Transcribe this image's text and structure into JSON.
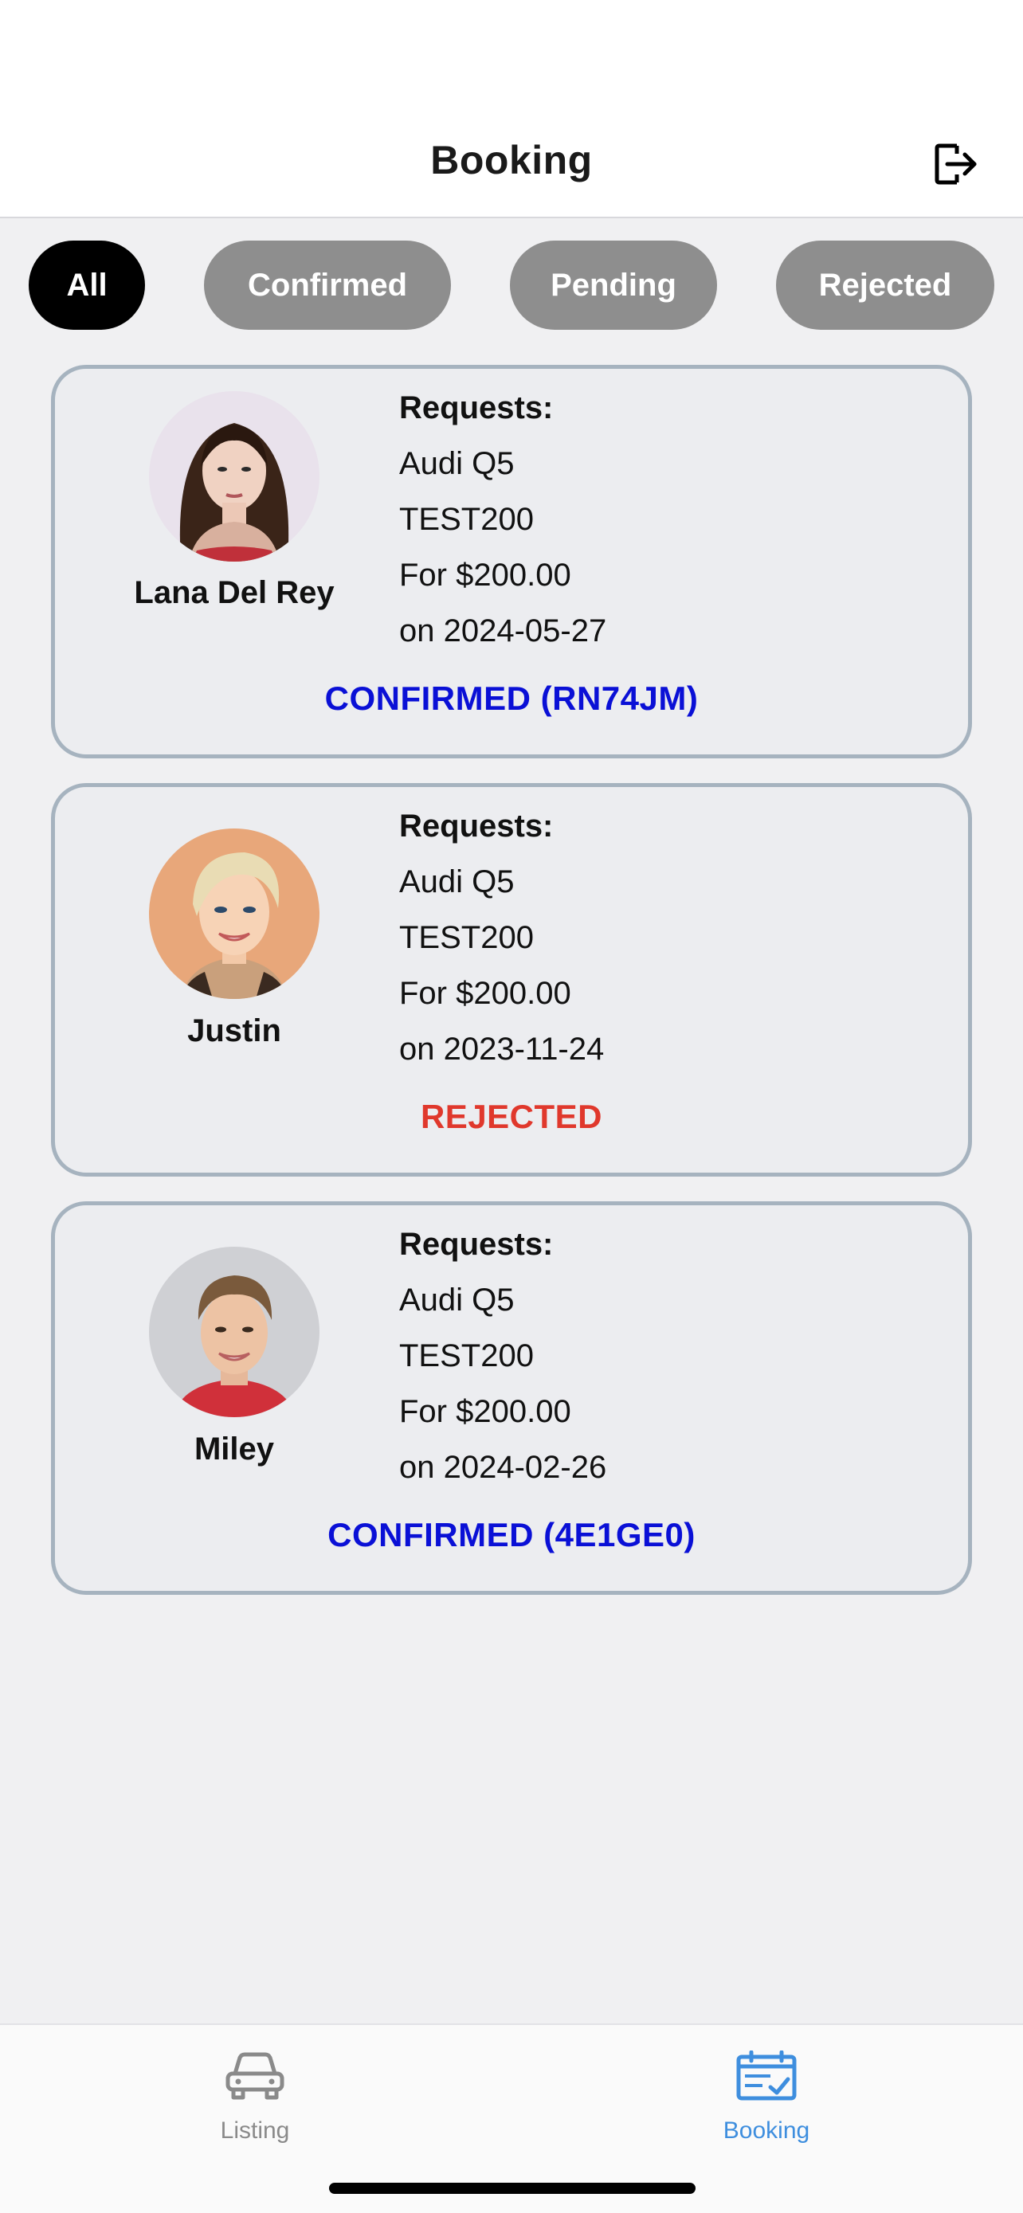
{
  "header": {
    "title": "Booking",
    "logout_icon": "logout-icon"
  },
  "filters": [
    {
      "label": "All",
      "active": true
    },
    {
      "label": "Confirmed",
      "active": false
    },
    {
      "label": "Pending",
      "active": false
    },
    {
      "label": "Rejected",
      "active": false
    }
  ],
  "bookings": [
    {
      "name": "Lana Del Rey",
      "heading": "Requests:",
      "car": "Audi Q5",
      "code": "TEST200",
      "price": "For $200.00",
      "date": "on 2024-05-27",
      "status": "CONFIRMED (RN74JM)",
      "status_type": "confirmed"
    },
    {
      "name": "Justin",
      "heading": "Requests:",
      "car": "Audi Q5",
      "code": "TEST200",
      "price": "For $200.00",
      "date": "on 2023-11-24",
      "status": "REJECTED",
      "status_type": "rejected"
    },
    {
      "name": "Miley",
      "heading": "Requests:",
      "car": "Audi Q5",
      "code": "TEST200",
      "price": "For $200.00",
      "date": "on 2024-02-26",
      "status": "CONFIRMED (4E1GE0)",
      "status_type": "confirmed"
    }
  ],
  "tabbar": {
    "items": [
      {
        "label": "Listing",
        "icon": "car-icon",
        "active": false
      },
      {
        "label": "Booking",
        "icon": "calendar-check-icon",
        "active": true
      }
    ]
  },
  "colors": {
    "confirmed": "#0a10d6",
    "rejected": "#e0382c",
    "active_tab": "#3e8ede",
    "pill_active": "#000000",
    "pill_inactive": "#8e8e8e"
  }
}
